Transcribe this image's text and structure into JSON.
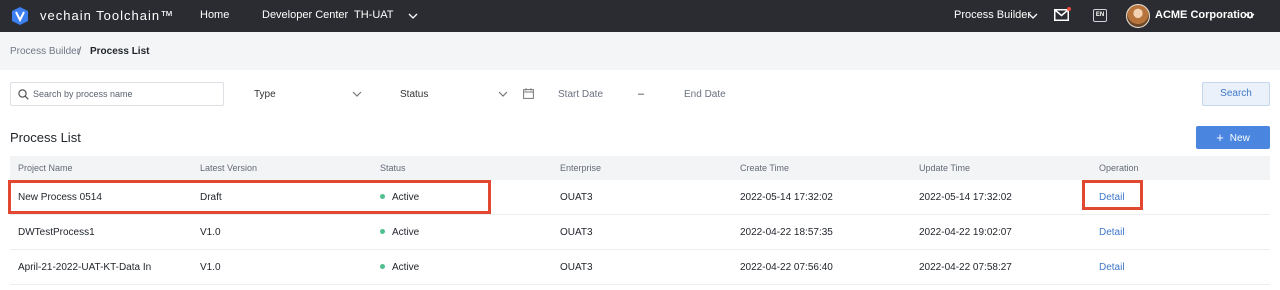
{
  "topbar": {
    "brand": "vechain Toolchain™",
    "nav": [
      "Home",
      "Developer Center",
      "TH-UAT"
    ],
    "process_builder": "Process Builder",
    "lang": "EN",
    "company": "ACME Corporation"
  },
  "breadcrumb": {
    "parent": "Process Builder",
    "separator": "/",
    "current": "Process List"
  },
  "filters": {
    "search_placeholder": "Search by process name",
    "type_label": "Type",
    "status_label": "Status",
    "start_date_placeholder": "Start Date",
    "date_separator": "–",
    "end_date_placeholder": "End Date",
    "search_button": "Search"
  },
  "section": {
    "title": "Process List",
    "new_button": "New"
  },
  "table": {
    "columns": [
      "Project Name",
      "Latest Version",
      "Status",
      "Enterprise",
      "Create Time",
      "Update Time",
      "Operation"
    ],
    "rows": [
      {
        "name": "New Process 0514",
        "version": "Draft",
        "status": "Active",
        "enterprise": "OUAT3",
        "created": "2022-05-14 17:32:02",
        "updated": "2022-05-14 17:32:02",
        "operation": "Detail"
      },
      {
        "name": "DWTestProcess1",
        "version": "V1.0",
        "status": "Active",
        "enterprise": "OUAT3",
        "created": "2022-04-22 18:57:35",
        "updated": "2022-04-22 19:02:07",
        "operation": "Detail"
      },
      {
        "name": "April-21-2022-UAT-KT-Data In",
        "version": "V1.0",
        "status": "Active",
        "enterprise": "OUAT3",
        "created": "2022-04-22 07:56:40",
        "updated": "2022-04-22 07:58:27",
        "operation": "Detail"
      }
    ]
  },
  "colors": {
    "topbar_bg": "#2a2c31",
    "accent_blue": "#4a86e0",
    "link_blue": "#3f77c9",
    "status_active": "#4fbf8f",
    "highlight_red": "#e2472f"
  }
}
